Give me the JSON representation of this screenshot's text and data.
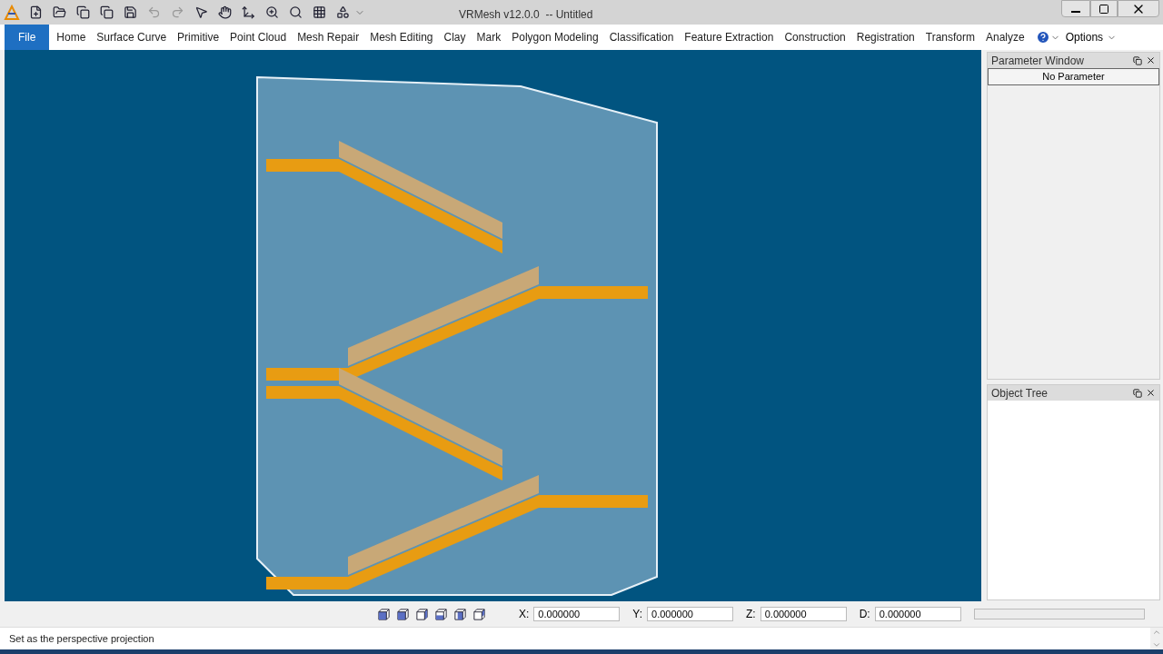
{
  "window": {
    "title": "VRMesh v12.0.0  -- Untitled"
  },
  "menu": {
    "tabs": [
      {
        "label": "File",
        "selected": true
      },
      {
        "label": "Home",
        "selected": false
      },
      {
        "label": "Surface Curve",
        "selected": false
      },
      {
        "label": "Primitive",
        "selected": false
      },
      {
        "label": "Point Cloud",
        "selected": false
      },
      {
        "label": "Mesh Repair",
        "selected": false
      },
      {
        "label": "Mesh Editing",
        "selected": false
      },
      {
        "label": "Clay",
        "selected": false
      },
      {
        "label": "Mark",
        "selected": false
      },
      {
        "label": "Polygon Modeling",
        "selected": false
      },
      {
        "label": "Classification",
        "selected": false
      },
      {
        "label": "Feature Extraction",
        "selected": false
      },
      {
        "label": "Construction",
        "selected": false
      },
      {
        "label": "Registration",
        "selected": false
      },
      {
        "label": "Transform",
        "selected": false
      },
      {
        "label": "Analyze",
        "selected": false
      }
    ],
    "options": "Options"
  },
  "parameter_window": {
    "title": "Parameter Window",
    "button": "No Parameter"
  },
  "object_tree": {
    "title": "Object Tree"
  },
  "coordinates": [
    {
      "label": "X:",
      "value": "0.000000"
    },
    {
      "label": "Y:",
      "value": "0.000000"
    },
    {
      "label": "Z:",
      "value": "0.000000"
    },
    {
      "label": "D:",
      "value": "0.000000"
    }
  ],
  "status_bar": "Set as the perspective projection"
}
